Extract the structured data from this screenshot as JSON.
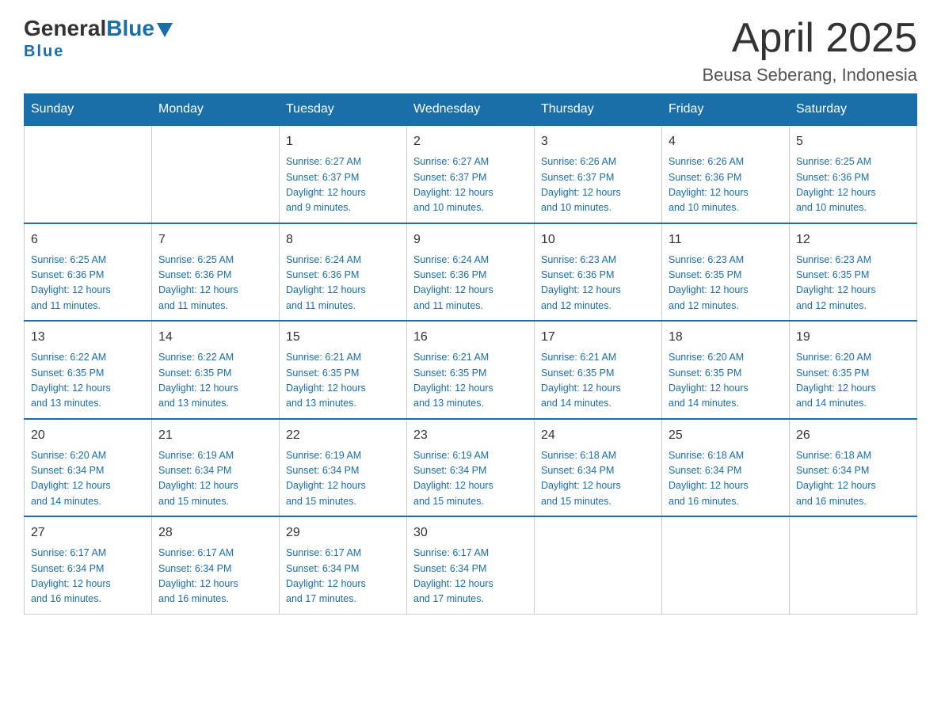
{
  "header": {
    "logo_general": "General",
    "logo_blue": "Blue",
    "month_year": "April 2025",
    "location": "Beusa Seberang, Indonesia"
  },
  "days_of_week": [
    "Sunday",
    "Monday",
    "Tuesday",
    "Wednesday",
    "Thursday",
    "Friday",
    "Saturday"
  ],
  "weeks": [
    [
      {
        "day": "",
        "info": ""
      },
      {
        "day": "",
        "info": ""
      },
      {
        "day": "1",
        "info": "Sunrise: 6:27 AM\nSunset: 6:37 PM\nDaylight: 12 hours\nand 9 minutes."
      },
      {
        "day": "2",
        "info": "Sunrise: 6:27 AM\nSunset: 6:37 PM\nDaylight: 12 hours\nand 10 minutes."
      },
      {
        "day": "3",
        "info": "Sunrise: 6:26 AM\nSunset: 6:37 PM\nDaylight: 12 hours\nand 10 minutes."
      },
      {
        "day": "4",
        "info": "Sunrise: 6:26 AM\nSunset: 6:36 PM\nDaylight: 12 hours\nand 10 minutes."
      },
      {
        "day": "5",
        "info": "Sunrise: 6:25 AM\nSunset: 6:36 PM\nDaylight: 12 hours\nand 10 minutes."
      }
    ],
    [
      {
        "day": "6",
        "info": "Sunrise: 6:25 AM\nSunset: 6:36 PM\nDaylight: 12 hours\nand 11 minutes."
      },
      {
        "day": "7",
        "info": "Sunrise: 6:25 AM\nSunset: 6:36 PM\nDaylight: 12 hours\nand 11 minutes."
      },
      {
        "day": "8",
        "info": "Sunrise: 6:24 AM\nSunset: 6:36 PM\nDaylight: 12 hours\nand 11 minutes."
      },
      {
        "day": "9",
        "info": "Sunrise: 6:24 AM\nSunset: 6:36 PM\nDaylight: 12 hours\nand 11 minutes."
      },
      {
        "day": "10",
        "info": "Sunrise: 6:23 AM\nSunset: 6:36 PM\nDaylight: 12 hours\nand 12 minutes."
      },
      {
        "day": "11",
        "info": "Sunrise: 6:23 AM\nSunset: 6:35 PM\nDaylight: 12 hours\nand 12 minutes."
      },
      {
        "day": "12",
        "info": "Sunrise: 6:23 AM\nSunset: 6:35 PM\nDaylight: 12 hours\nand 12 minutes."
      }
    ],
    [
      {
        "day": "13",
        "info": "Sunrise: 6:22 AM\nSunset: 6:35 PM\nDaylight: 12 hours\nand 13 minutes."
      },
      {
        "day": "14",
        "info": "Sunrise: 6:22 AM\nSunset: 6:35 PM\nDaylight: 12 hours\nand 13 minutes."
      },
      {
        "day": "15",
        "info": "Sunrise: 6:21 AM\nSunset: 6:35 PM\nDaylight: 12 hours\nand 13 minutes."
      },
      {
        "day": "16",
        "info": "Sunrise: 6:21 AM\nSunset: 6:35 PM\nDaylight: 12 hours\nand 13 minutes."
      },
      {
        "day": "17",
        "info": "Sunrise: 6:21 AM\nSunset: 6:35 PM\nDaylight: 12 hours\nand 14 minutes."
      },
      {
        "day": "18",
        "info": "Sunrise: 6:20 AM\nSunset: 6:35 PM\nDaylight: 12 hours\nand 14 minutes."
      },
      {
        "day": "19",
        "info": "Sunrise: 6:20 AM\nSunset: 6:35 PM\nDaylight: 12 hours\nand 14 minutes."
      }
    ],
    [
      {
        "day": "20",
        "info": "Sunrise: 6:20 AM\nSunset: 6:34 PM\nDaylight: 12 hours\nand 14 minutes."
      },
      {
        "day": "21",
        "info": "Sunrise: 6:19 AM\nSunset: 6:34 PM\nDaylight: 12 hours\nand 15 minutes."
      },
      {
        "day": "22",
        "info": "Sunrise: 6:19 AM\nSunset: 6:34 PM\nDaylight: 12 hours\nand 15 minutes."
      },
      {
        "day": "23",
        "info": "Sunrise: 6:19 AM\nSunset: 6:34 PM\nDaylight: 12 hours\nand 15 minutes."
      },
      {
        "day": "24",
        "info": "Sunrise: 6:18 AM\nSunset: 6:34 PM\nDaylight: 12 hours\nand 15 minutes."
      },
      {
        "day": "25",
        "info": "Sunrise: 6:18 AM\nSunset: 6:34 PM\nDaylight: 12 hours\nand 16 minutes."
      },
      {
        "day": "26",
        "info": "Sunrise: 6:18 AM\nSunset: 6:34 PM\nDaylight: 12 hours\nand 16 minutes."
      }
    ],
    [
      {
        "day": "27",
        "info": "Sunrise: 6:17 AM\nSunset: 6:34 PM\nDaylight: 12 hours\nand 16 minutes."
      },
      {
        "day": "28",
        "info": "Sunrise: 6:17 AM\nSunset: 6:34 PM\nDaylight: 12 hours\nand 16 minutes."
      },
      {
        "day": "29",
        "info": "Sunrise: 6:17 AM\nSunset: 6:34 PM\nDaylight: 12 hours\nand 17 minutes."
      },
      {
        "day": "30",
        "info": "Sunrise: 6:17 AM\nSunset: 6:34 PM\nDaylight: 12 hours\nand 17 minutes."
      },
      {
        "day": "",
        "info": ""
      },
      {
        "day": "",
        "info": ""
      },
      {
        "day": "",
        "info": ""
      }
    ]
  ]
}
